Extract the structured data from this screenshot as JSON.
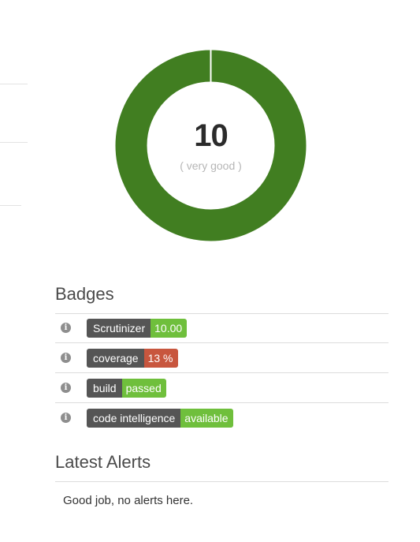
{
  "score": {
    "value": "10",
    "label": "( very good )",
    "ring_color": "#417e21",
    "fill_fraction": 1.0
  },
  "badges": {
    "heading": "Badges",
    "items": [
      {
        "name": "Scrutinizer",
        "value": "10.00",
        "color": "#6fbf3c"
      },
      {
        "name": "coverage",
        "value": "13 %",
        "color": "#c8563e"
      },
      {
        "name": "build",
        "value": "passed",
        "color": "#6fbf3c"
      },
      {
        "name": "code intelligence",
        "value": "available",
        "color": "#6fbf3c"
      }
    ],
    "info_icon": "info-circle-icon"
  },
  "alerts": {
    "heading": "Latest Alerts",
    "message": "Good job, no alerts here."
  }
}
